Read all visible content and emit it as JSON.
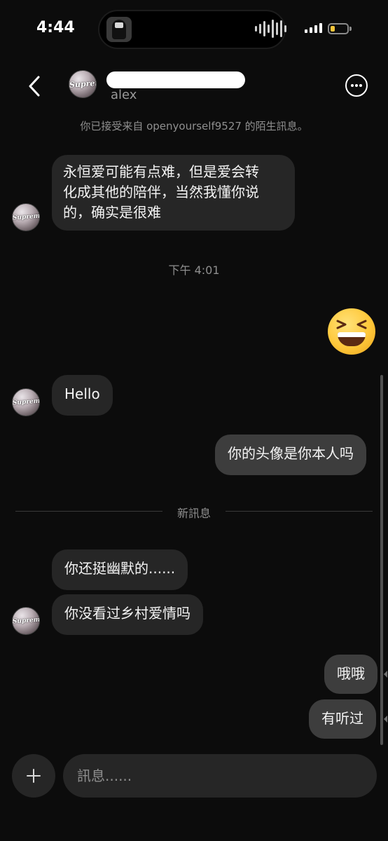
{
  "status_bar": {
    "time": "4:44",
    "battery_level": 0.25
  },
  "header": {
    "username": "alex",
    "avatar_logo": "Supreme",
    "back_icon": "chevron-left-icon",
    "more_icon": "ellipsis-circle-icon"
  },
  "system_note": "你已接受来自 openyourself9527 的陌生訊息。",
  "timestamp": "下午 4:01",
  "new_messages_label": "新訊息",
  "messages": [
    {
      "sender": "them",
      "text": "永恒爱可能有点难，但是爱会转化成其他的陪伴，当然我懂你说的，确实是很难"
    },
    {
      "sender": "me",
      "type": "emoji",
      "emoji": "grinning-squinting-face"
    },
    {
      "sender": "them",
      "text": "Hello"
    },
    {
      "sender": "me",
      "text": "你的头像是你本人吗"
    },
    {
      "sender": "them",
      "text": "你还挺幽默的......"
    },
    {
      "sender": "them",
      "text": "你没看过乡村爱情吗"
    },
    {
      "sender": "me",
      "text": "哦哦"
    },
    {
      "sender": "me",
      "text": "有听过"
    }
  ],
  "message_lines": {
    "m0": [
      "永恒爱可能有点难，但是爱会转",
      "化成其他的陪伴，当然我懂你说",
      "的，确实是很难"
    ]
  },
  "composer": {
    "placeholder": "訊息......",
    "plus_icon": "plus-icon"
  },
  "colors": {
    "background": "#0c0c0c",
    "incoming_bubble": "#262626",
    "outgoing_bubble": "#3d3d3d",
    "battery": "#f5c63b"
  }
}
